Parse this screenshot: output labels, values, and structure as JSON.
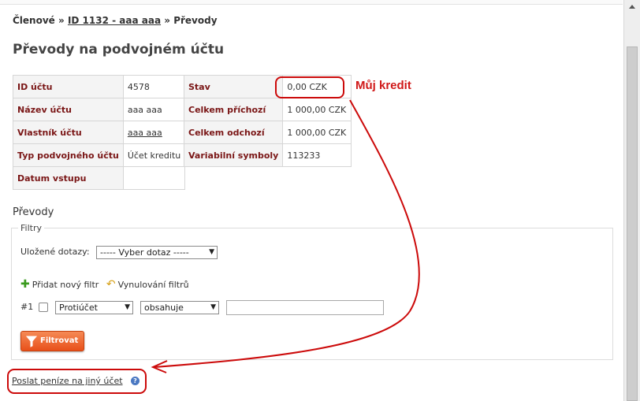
{
  "breadcrumb": {
    "item1": "Členové",
    "sep1": "»",
    "item2": "ID 1132 - aaa aaa",
    "sep2": "»",
    "item3": "Převody"
  },
  "page": {
    "title": "Převody na podvojném účtu"
  },
  "account_table": [
    {
      "label": "ID účtu",
      "value": "4578"
    },
    {
      "label": "Název účtu",
      "value": "aaa aaa"
    },
    {
      "label": "Vlastník účtu",
      "value": "aaa aaa"
    },
    {
      "label": "Typ podvojného účtu",
      "value": "Účet kreditu"
    },
    {
      "label": "Datum vstupu",
      "value": ""
    }
  ],
  "balance_table": [
    {
      "label": "Stav",
      "value": "0,00 CZK"
    },
    {
      "label": "Celkem příchozí",
      "value": "1 000,00 CZK"
    },
    {
      "label": "Celkem odchozí",
      "value": "1 000,00 CZK"
    },
    {
      "label": "Variabilní symboly",
      "value": "113233"
    }
  ],
  "annotation": {
    "text": "Můj kredit",
    "color": "#d01818"
  },
  "transfers": {
    "title": "Převody",
    "filters_legend": "Filtry",
    "saved_queries_label": "Uložené dotazy:",
    "saved_queries_value": "----- Vyber dotaz -----",
    "add_filter": "Přidat nový filtr",
    "reset_filters": "Vynulování filtrů",
    "row_number": "#1",
    "field_value": "Protiúčet",
    "operator_value": "obsahuje",
    "filter_button": "Filtrovat"
  },
  "send_money_link": "Poslat peníze na jiný účet",
  "help_icon": "?",
  "icons": [
    "plus-icon",
    "undo-icon",
    "funnel-icon",
    "help-icon",
    "chevron-down-icon"
  ],
  "colors": {
    "label_text": "#7a1616",
    "button_orange": "#e8501a",
    "annotation_red": "#cc0a0a"
  }
}
